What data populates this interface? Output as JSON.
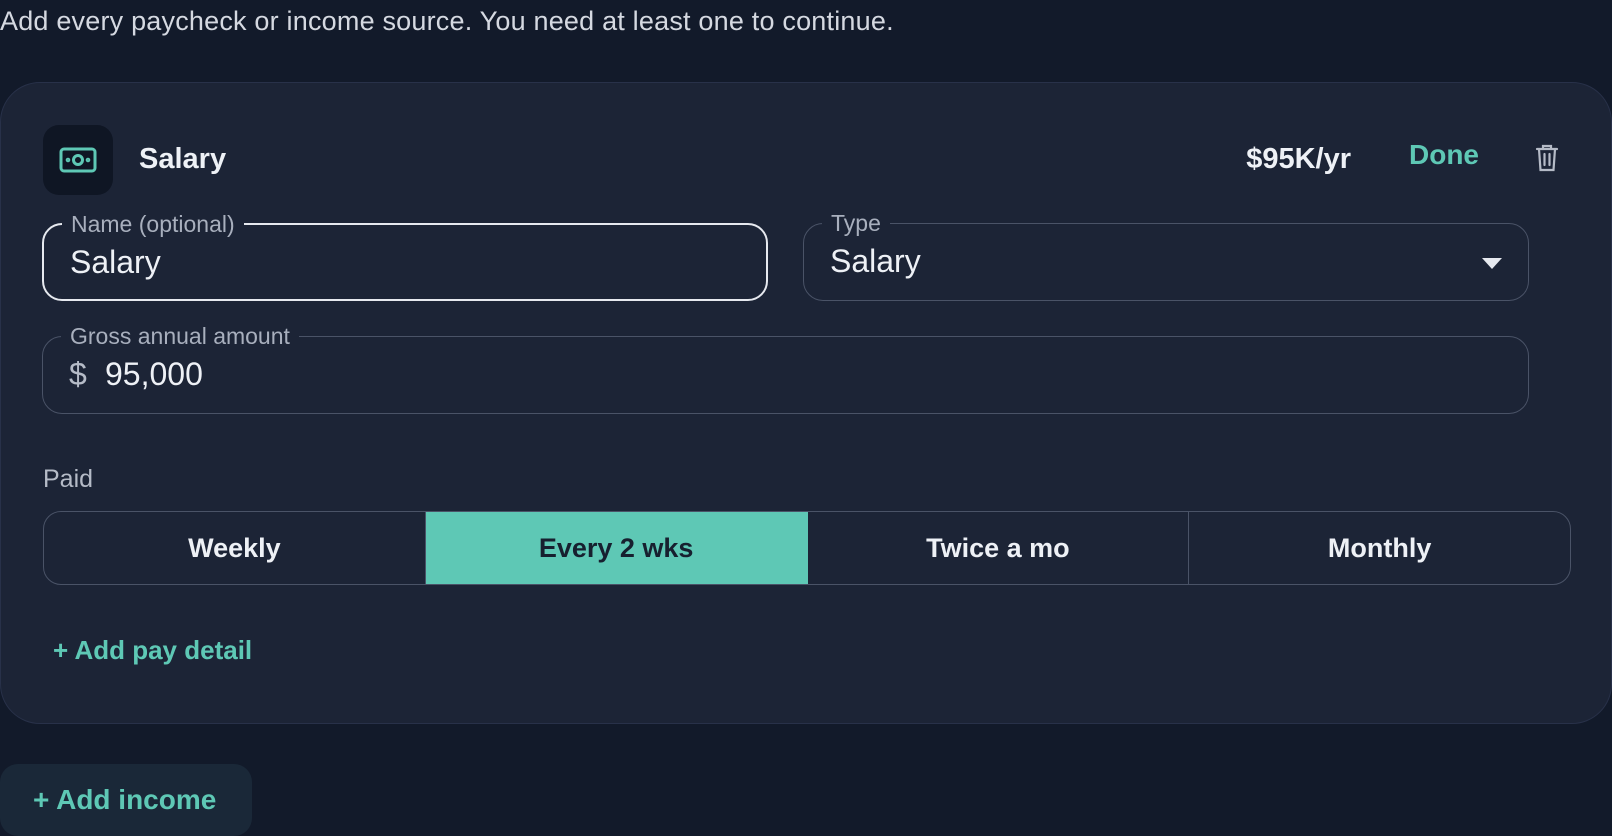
{
  "intro_text": "Add every paycheck or income source. You need at least one to continue.",
  "income_card": {
    "icon": "banknote-icon",
    "title": "Salary",
    "summary": "$95K/yr",
    "done_label": "Done",
    "delete_icon": "trash-icon",
    "name_field": {
      "label": "Name (optional)",
      "value": "Salary"
    },
    "type_field": {
      "label": "Type",
      "value": "Salary"
    },
    "amount_field": {
      "label": "Gross annual amount",
      "prefix": "$",
      "value": "95,000"
    },
    "paid": {
      "label": "Paid",
      "options": [
        "Weekly",
        "Every 2 wks",
        "Twice a mo",
        "Monthly"
      ],
      "selected": "Every 2 wks"
    },
    "add_detail_label": "+ Add pay detail"
  },
  "add_income_label": "+ Add income",
  "colors": {
    "accent": "#5ec8b5",
    "background": "#121a2a",
    "card": "#1c2436"
  }
}
